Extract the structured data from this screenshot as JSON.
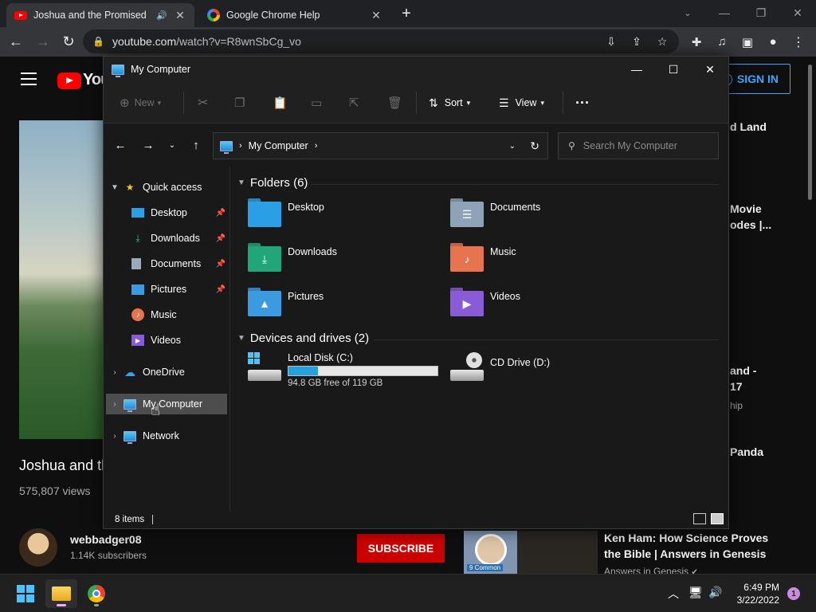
{
  "chrome": {
    "tabs": [
      {
        "title": "Joshua and the Promised Land",
        "icon": "youtube-icon"
      },
      {
        "title": "Google Chrome Help",
        "icon": "google-icon"
      }
    ],
    "url_host": "youtube.com",
    "url_path": "/watch?v=R8wnSbCg_vo"
  },
  "youtube": {
    "logo_text": "You",
    "sign_in": "SIGN IN",
    "video_title": "Joshua and th",
    "views": "575,807 views",
    "channel": "webbadger08",
    "subscribers": "1.14K subscribers",
    "subscribe": "SUBSCRIBE",
    "side_items": [
      {
        "line1": "d Land"
      },
      {
        "line1": "Movie",
        "line2": "odes |..."
      },
      {
        "line1": "and -",
        "line2": "17",
        "small": "hip"
      },
      {
        "line1": "Panda"
      }
    ],
    "related": {
      "title": "Ken Ham: How Science Proves the Bible | Answers in Genesis",
      "channel": "Answers in Genesis",
      "thumb_caption": "9 Common"
    }
  },
  "explorer": {
    "title": "My Computer",
    "commands": {
      "new": "New",
      "sort": "Sort",
      "view": "View"
    },
    "address": "My Computer",
    "search_placeholder": "Search My Computer",
    "nav": {
      "quick_access": "Quick access",
      "quick_items": [
        "Desktop",
        "Downloads",
        "Documents",
        "Pictures",
        "Music",
        "Videos"
      ],
      "onedrive": "OneDrive",
      "my_computer": "My Computer",
      "network": "Network"
    },
    "folders_header": "Folders (6)",
    "folders": [
      {
        "name": "Desktop",
        "color": "#2b9fe6"
      },
      {
        "name": "Documents",
        "color": "#8fa3b8"
      },
      {
        "name": "Downloads",
        "color": "#21a67a"
      },
      {
        "name": "Music",
        "color": "#e8734f"
      },
      {
        "name": "Pictures",
        "color": "#3c9ae0"
      },
      {
        "name": "Videos",
        "color": "#8a5bd6"
      }
    ],
    "drives_header": "Devices and drives (2)",
    "drives": [
      {
        "name": "Local Disk (C:)",
        "free_text": "94.8 GB free of 119 GB",
        "used_fraction": 0.2
      },
      {
        "name": "CD Drive (D:)"
      }
    ],
    "status": "8 items"
  },
  "taskbar": {
    "time": "6:49 PM",
    "date": "3/22/2022",
    "notifications": "1"
  }
}
